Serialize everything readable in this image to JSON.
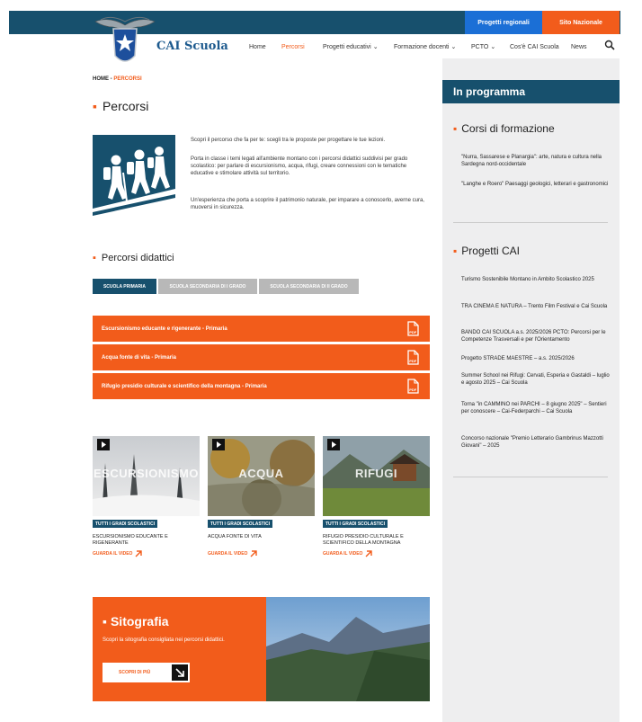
{
  "header": {
    "logo_text": "CAI Scuola",
    "top_buttons": [
      "Progetti regionali",
      "Sito Nazionale"
    ],
    "nav": [
      {
        "label": "Home",
        "chevron": false
      },
      {
        "label": "Percorsi",
        "chevron": false,
        "active": true
      },
      {
        "label": "Progetti educativi",
        "chevron": true
      },
      {
        "label": "Formazione docenti",
        "chevron": true
      },
      {
        "label": "PCTO",
        "chevron": true
      },
      {
        "label": "Cos'è CAI Scuola",
        "chevron": false
      },
      {
        "label": "News",
        "chevron": false
      }
    ]
  },
  "breadcrumb": {
    "home": "HOME",
    "sep": " - ",
    "current": "PERCORSI"
  },
  "page": {
    "title": "Percorsi",
    "intro": [
      "Scopri il percorso che fa per te: scegli tra le proposte per progettare le tue lezioni.",
      "Porta in classe i temi legati all'ambiente montano con i percorsi didattici suddivisi per grado scolastico: per parlare di escursionismo, acqua, rifugi, creare connessioni con le tematiche educative e stimolare attività sul territorio.",
      "Un'esperienza che porta a scoprire il patrimonio naturale, per imparare a conoscerlo, averne cura, muoversi in sicurezza."
    ]
  },
  "didattici": {
    "title": "Percorsi didattici",
    "tabs": [
      "SCUOLA PRIMARIA",
      "SCUOLA SECONDARIA DI I GRADO",
      "SCUOLA SECONDARIA DI II GRADO"
    ],
    "items": [
      "Escursionismo educante e rigenerante - Primaria",
      "Acqua fonte di vita - Primaria",
      "Rifugio presidio culturale e scientifico della montagna - Primaria"
    ]
  },
  "videos": [
    {
      "overlay": "ESCURSIONISMO",
      "badge": "TUTTI I GRADI SCOLASTICI",
      "title": "ESCURSIONISMO EDUCANTE E RIGENERANTE",
      "link": "GUARDA IL VIDEO"
    },
    {
      "overlay": "ACQUA",
      "badge": "TUTTI I GRADI SCOLASTICI",
      "title": "ACQUA FONTE DI VITA",
      "link": "GUARDA IL VIDEO"
    },
    {
      "overlay": "RIFUGI",
      "badge": "TUTTI I GRADI SCOLASTICI",
      "title": "RIFUGIO PRESIDIO CULTURALE E SCIENTIFICO DELLA MONTAGNA",
      "link": "GUARDA IL VIDEO"
    }
  ],
  "sitografia": {
    "title": "Sitografia",
    "desc": "Scopri la sitografia consigliata nei percorsi didattici.",
    "button": "SCOPRI DI PIÙ"
  },
  "sidebar": {
    "heading": "In programma",
    "corsi_title": "Corsi di formazione",
    "corsi": [
      "\"Nurra, Sassarese e Planargia\": arte, natura e cultura nella Sardegna nord-occidentale",
      "\"Langhe e Roero\" Paesaggi geologici, letterari e gastronomici"
    ],
    "progetti_title": "Progetti CAI",
    "progetti": [
      "Turismo Sostenibile Montano in Ambito Scolastico 2025",
      "TRA CINEMA E NATURA – Trento Film Festival e Cai Scuola",
      "BANDO CAI SCUOLA a.s. 2025/2026 PCTO: Percorsi per le Competenze Trasversali e per l'Orientamento",
      "Progetto STRADE MAESTRE – a.s. 2025/2026",
      "Summer School nei Rifugi: Cervati, Esperia e Gastaldi – luglio e agosto 2025 – Cai Scuola",
      "Torna \"in CAMMINO nei PARCHI – 8 giugno 2025\" – Sentieri per conoscere – Cai-Federparchi – Cai Scuola",
      "Concorso nazionale \"Premio Letterario Gambrinus Mazzotti Giovani\" – 2025"
    ]
  },
  "colors": {
    "navy": "#17506d",
    "orange": "#f25c1b",
    "blue": "#1b6fd6",
    "sidebar_bg": "#eeeeef"
  }
}
